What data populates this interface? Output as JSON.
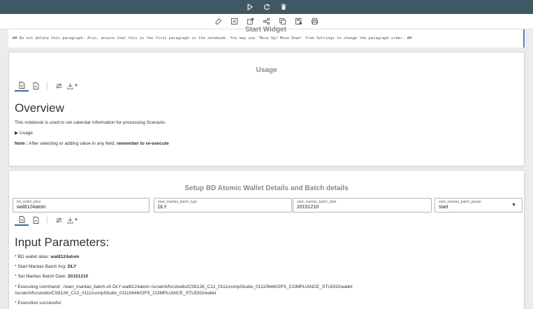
{
  "toolbar": {
    "icons": [
      "play-icon",
      "refresh-icon",
      "delete-icon"
    ]
  },
  "secondary_toolbar": {
    "icons": [
      "eraser-icon",
      "expand-icon",
      "export-icon",
      "share-icon",
      "copy-icon",
      "save-icon",
      "print-icon"
    ]
  },
  "paragraph1": {
    "title": "Start Widget",
    "code": "## Do not delete this paragraph. Also, ensure that this is the first paragraph in the notebook. You may use 'Move Up/ Move  Down' from Settings to change the paragraph order. ##"
  },
  "paragraph2": {
    "title": "Usage",
    "heading": "Overview",
    "description": "This notebook is used to set calendar information for processing Scenario.",
    "toggle": "▶  Usage",
    "note_label": "Note :",
    "note_text": " After selecting or adding value in any field, ",
    "note_emphasis": "remember to re-execute"
  },
  "paragraph3": {
    "title": "Setup BD Atomic Wallet Details and Batch details",
    "fields": [
      {
        "label": "bd_wallet_alias",
        "value": "wal8124atom"
      },
      {
        "label": "start_mantas_batch_type",
        "value": "DLY"
      },
      {
        "label": "start_mantas_batch_date",
        "value": "20151210"
      },
      {
        "label": "start_mantas_batch_param",
        "value": "start"
      }
    ],
    "heading": "Input Parameters:",
    "lines": [
      {
        "prefix": "* BD wallet alias: ",
        "value": "wal8124atom"
      },
      {
        "prefix": "* Start Mantas Batch Arg: ",
        "value": "DLY"
      },
      {
        "prefix": "* Set Mantas Batch Date: ",
        "value": "20151210"
      }
    ],
    "command_line1": "* Executing command: ./start_mantas_batch.sh DLY wal8124atom /scratch/fccstudio/CS8126_C12_0111/compStudio_01110646/OFS_COMPLIANCE_STUDIO/wallet",
    "command_line2": "/scratch/fccstudio/CS8126_C12_0111/compStudio_01110646/OFS_COMPLIANCE_STUDIO/wallet",
    "status": "* Execution successful"
  }
}
